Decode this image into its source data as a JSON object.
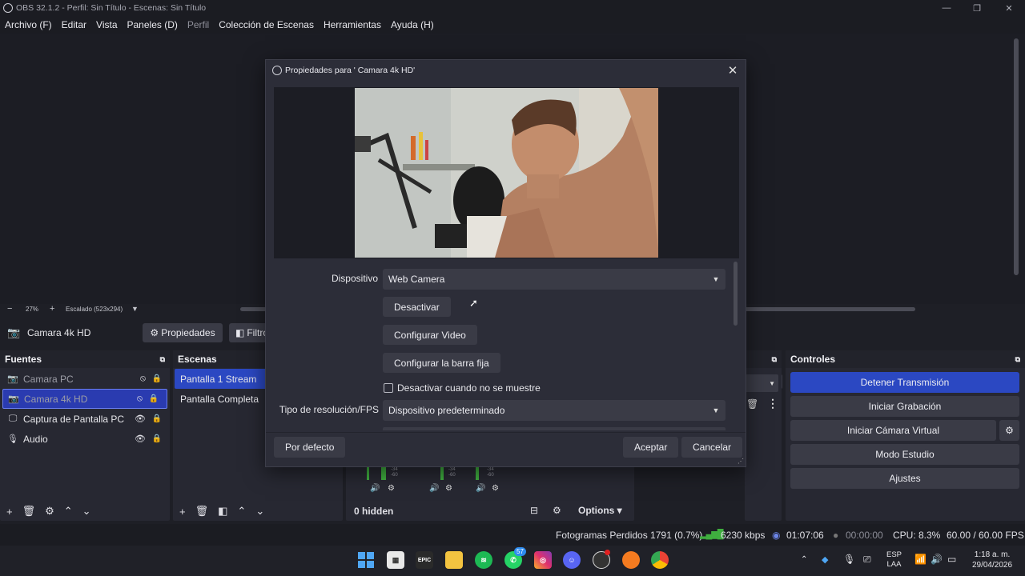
{
  "window": {
    "title": "OBS 32.1.2 - Perfil: Sin Título - Escenas: Sin Título"
  },
  "menu": [
    {
      "label": "Archivo (F)",
      "enabled": true
    },
    {
      "label": "Editar",
      "enabled": true
    },
    {
      "label": "Vista",
      "enabled": true
    },
    {
      "label": "Paneles (D)",
      "enabled": true
    },
    {
      "label": "Perfil",
      "enabled": false
    },
    {
      "label": "Colección de Escenas",
      "enabled": true
    },
    {
      "label": "Herramientas",
      "enabled": true
    },
    {
      "label": "Ayuda (H)",
      "enabled": true
    }
  ],
  "zoom": {
    "percent": "27%",
    "scale_label": "Escalado (523x294)"
  },
  "source_toolbar": {
    "source_name": "Camara 4k HD",
    "properties_label": "Propiedades",
    "filters_label": "Filtro"
  },
  "sources": {
    "title": "Fuentes",
    "items": [
      {
        "icon": "camera-icon",
        "label": "Camara PC",
        "visible": false,
        "selected": false
      },
      {
        "icon": "camera-icon",
        "label": "Camara 4k HD",
        "visible": false,
        "selected": true
      },
      {
        "icon": "monitor-icon",
        "label": "Captura de Pantalla PC",
        "visible": true,
        "selected": false
      },
      {
        "icon": "mic-icon",
        "label": "Audio",
        "visible": true,
        "selected": false
      }
    ]
  },
  "scenes": {
    "title": "Escenas",
    "items": [
      {
        "label": "Pantalla 1 Stream",
        "selected": true
      },
      {
        "label": "Pantalla Completa",
        "selected": false
      }
    ]
  },
  "mixer": {
    "hidden_label": "0 hidden",
    "options_label": "Options",
    "meter_ticks": [
      "-34",
      "-60"
    ]
  },
  "controls": {
    "title": "Controles",
    "buttons": [
      "Detener Transmisión",
      "Iniciar Grabación",
      "Iniciar Cámara Virtual",
      "Modo Estudio",
      "Ajustes"
    ]
  },
  "status": {
    "dropped_frames": "Fotogramas Perdidos 1791 (0.7%)",
    "bitrate": "6230 kbps",
    "stream_time": "01:07:06",
    "record_time": "00:00:00",
    "cpu": "CPU: 8.3%",
    "fps": "60.00 / 60.00 FPS"
  },
  "dialog": {
    "title": "Propiedades para ' Camara 4k HD'",
    "device_label": "Dispositivo",
    "device_value": "Web Camera",
    "deactivate_button": "Desactivar",
    "config_video_button": "Configurar Video",
    "config_crossbar_button": "Configurar la barra fija",
    "hide_checkbox_label": "Desactivar cuando no se muestre",
    "hide_checkbox_checked": false,
    "resolution_label": "Tipo de resolución/FPS",
    "resolution_value": "Dispositivo predeterminado",
    "defaults_button": "Por defecto",
    "accept_button": "Aceptar",
    "cancel_button": "Cancelar"
  },
  "taskbar": {
    "epic_label": "EPIC",
    "whatsapp_badge": "57",
    "lang_top": "ESP",
    "lang_bottom": "LAA",
    "time": "1:18 a. m.",
    "date": "29/04/2026"
  },
  "colors": {
    "accent": "#2b48c2",
    "selected_row": "#2a3bb0",
    "dock_bg": "#272832",
    "app_bg": "#1e1f26",
    "meter_green": "#3fae3f"
  }
}
